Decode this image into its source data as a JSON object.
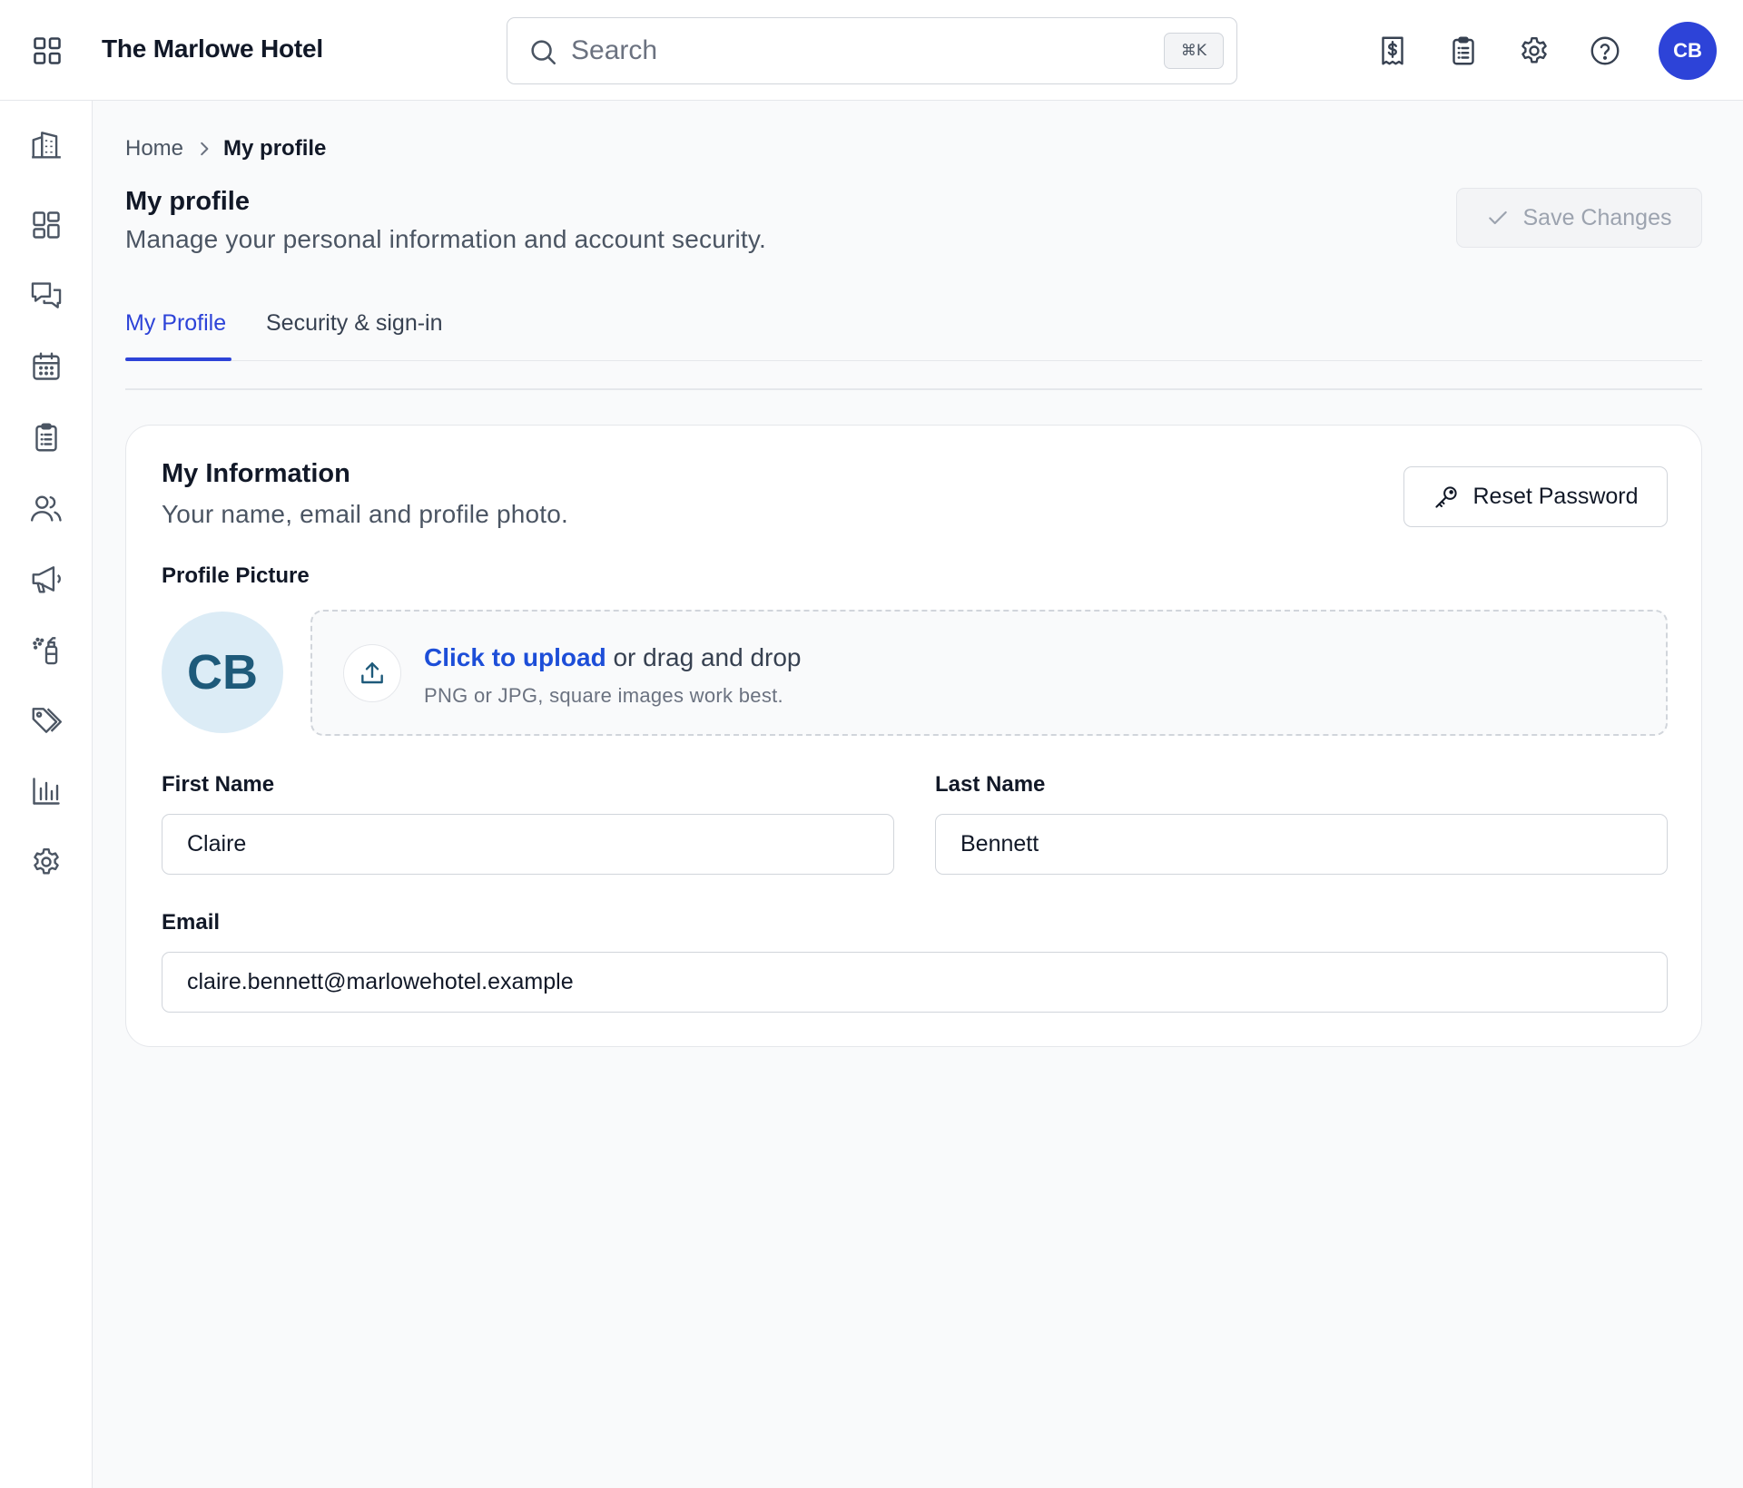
{
  "app": {
    "hotel_name": "The Marlowe Hotel",
    "search": {
      "placeholder": "Search",
      "shortcut": "⌘K"
    },
    "top_icons": [
      "receipt-dollar-icon",
      "clipboard-list-icon",
      "gear-icon",
      "help-circle-icon"
    ],
    "user_initials": "CB"
  },
  "sidebar": {
    "items": [
      {
        "name": "building-icon"
      },
      {
        "name": "dashboard-grid-icon"
      },
      {
        "name": "chat-bubbles-icon"
      },
      {
        "name": "calendar-icon"
      },
      {
        "name": "clipboard-icon"
      },
      {
        "name": "users-icon"
      },
      {
        "name": "megaphone-icon"
      },
      {
        "name": "cleaning-spray-icon"
      },
      {
        "name": "tags-icon"
      },
      {
        "name": "bar-chart-icon"
      },
      {
        "name": "gear-icon"
      }
    ]
  },
  "breadcrumb": {
    "home": "Home",
    "current": "My profile"
  },
  "page": {
    "title": "My profile",
    "subtitle": "Manage your personal information and account security.",
    "save_label": "Save Changes"
  },
  "tabs": [
    {
      "label": "My Profile",
      "active": true
    },
    {
      "label": "Security & sign-in",
      "active": false
    }
  ],
  "card": {
    "title": "My Information",
    "subtitle": "Your name, email and profile photo.",
    "reset_label": "Reset Password",
    "profile_picture_label": "Profile Picture",
    "avatar_initials": "CB",
    "upload": {
      "link_text": "Click to upload",
      "rest_text": " or drag and drop",
      "hint": "PNG or JPG, square images work best."
    },
    "first_name": {
      "label": "First Name",
      "value": "Claire"
    },
    "last_name": {
      "label": "Last Name",
      "value": "Bennett"
    },
    "email": {
      "label": "Email",
      "value": "claire.bennett@marlowehotel.example"
    }
  },
  "colors": {
    "accent": "#2d43d8",
    "link": "#1d4ed8",
    "avatar_bg": "#dcecf6",
    "avatar_text": "#1e5a7a"
  }
}
